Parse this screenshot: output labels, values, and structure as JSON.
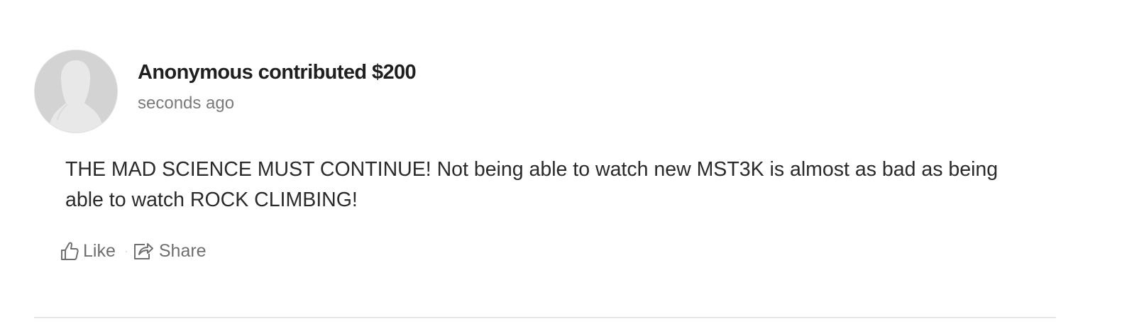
{
  "comment": {
    "avatar_icon": "default-user-silhouette",
    "title": "Anonymous contributed $200",
    "timestamp": "seconds ago",
    "message": "THE MAD SCIENCE MUST CONTINUE! Not being able to watch new MST3K is almost as bad as being able to watch ROCK CLIMBING!",
    "actions": {
      "like_label": "Like",
      "like_icon": "thumbs-up-outline-icon",
      "separator": "·",
      "share_label": "Share",
      "share_icon": "share-arrow-icon"
    }
  },
  "colors": {
    "title": "#1f1f1f",
    "timestamp": "#7a7a7a",
    "message": "#2a2a2a",
    "actions": "#6f6f6f",
    "avatar_bg": "#d3d3d3",
    "divider": "#e6e6e6"
  }
}
